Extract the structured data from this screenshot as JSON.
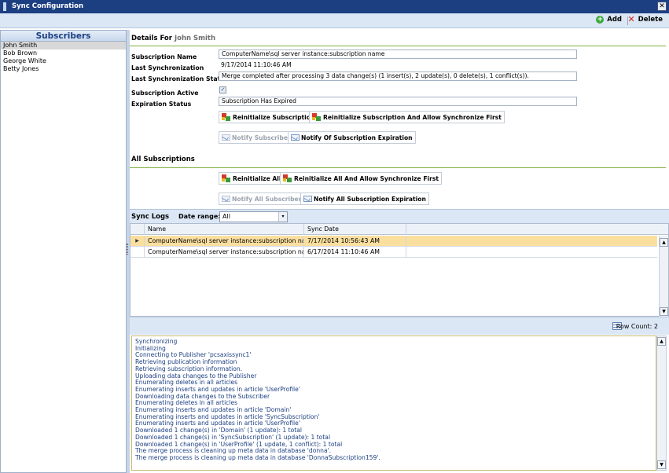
{
  "window": {
    "title": "Sync Configuration",
    "close_glyph": "✕"
  },
  "toolbar": {
    "add_label": "Add",
    "delete_label": "Delete"
  },
  "subscribers": {
    "header": "Subscribers",
    "items": [
      "John Smith",
      "Bob Brown",
      "George White",
      "Betty Jones"
    ],
    "selected": "John Smith"
  },
  "details": {
    "title_prefix": "Details For",
    "title_name": "John Smith",
    "subscription_name_label": "Subscription Name",
    "subscription_name": "ComputerName\\sql server instance:subscription name",
    "last_sync_label": "Last Synchronization",
    "last_sync": "9/17/2014 11:10:46 AM",
    "last_sync_status_label": "Last Synchronization Status",
    "last_sync_status": "Merge completed after processing 3 data change(s) (1 insert(s), 2 update(s), 0 delete(s), 1 conflict(s)).",
    "subscription_active_label": "Subscription Active",
    "subscription_active": true,
    "expiration_status_label": "Expiration Status",
    "expiration_status": "Subscription Has Expired",
    "reinit_label": "Reinitialize Subscription",
    "reinit_allow_label": "Reinitialize Subscription And Allow Synchronize First",
    "notify_subscriber_label": "Notify Subscriber",
    "notify_expiration_label": "Notify Of Subscription Expiration"
  },
  "all_subscriptions": {
    "title": "All Subscriptions",
    "reinit_all_label": "Reinitialize All",
    "reinit_all_allow_label": "Reinitialize All And Allow Synchronize First",
    "notify_all_label": "Notify All Subscribers",
    "notify_all_expiration_label": "Notify All Subscription Expiration"
  },
  "sync_logs": {
    "title": "Sync Logs",
    "date_range_label": "Date range:",
    "date_range_value": "All",
    "columns": [
      "Name",
      "Sync Date"
    ],
    "rows": [
      {
        "name": "ComputerName\\sql server instance:subscription name",
        "date": "7/17/2014 10:56:43 AM"
      },
      {
        "name": "ComputerName\\sql server instance:subscription name",
        "date": "6/17/2014 11:10:46 AM"
      }
    ],
    "row_count_label": "Row Count:",
    "row_count": "2"
  },
  "log_output": [
    "Synchronizing",
    "Initializing",
    "Connecting to Publisher 'pcsaxissync1'",
    "Retrieving publication information",
    "Retrieving subscription information.",
    "Uploading data changes to the Publisher",
    "Enumerating deletes in all articles",
    "Enumerating inserts and updates in article 'UserProfile'",
    "Downloading data changes to the Subscriber",
    "Enumerating deletes in all articles",
    "Enumerating inserts and updates in article 'Domain'",
    "Enumerating inserts and updates in article 'SyncSubscription'",
    "Enumerating inserts and updates in article 'UserProfile'",
    "Downloaded 1 change(s) in 'Domain' (1 update): 1 total",
    "Downloaded 1 change(s) in 'SyncSubscription' (1 update): 1 total",
    "Downloaded 1 change(s) in 'UserProfile' (1 update, 1 conflict): 1 total",
    "The merge process is cleaning up meta data in database 'donna'.",
    "The merge process is cleaning up meta data in database 'DonnaSubscription159'."
  ]
}
